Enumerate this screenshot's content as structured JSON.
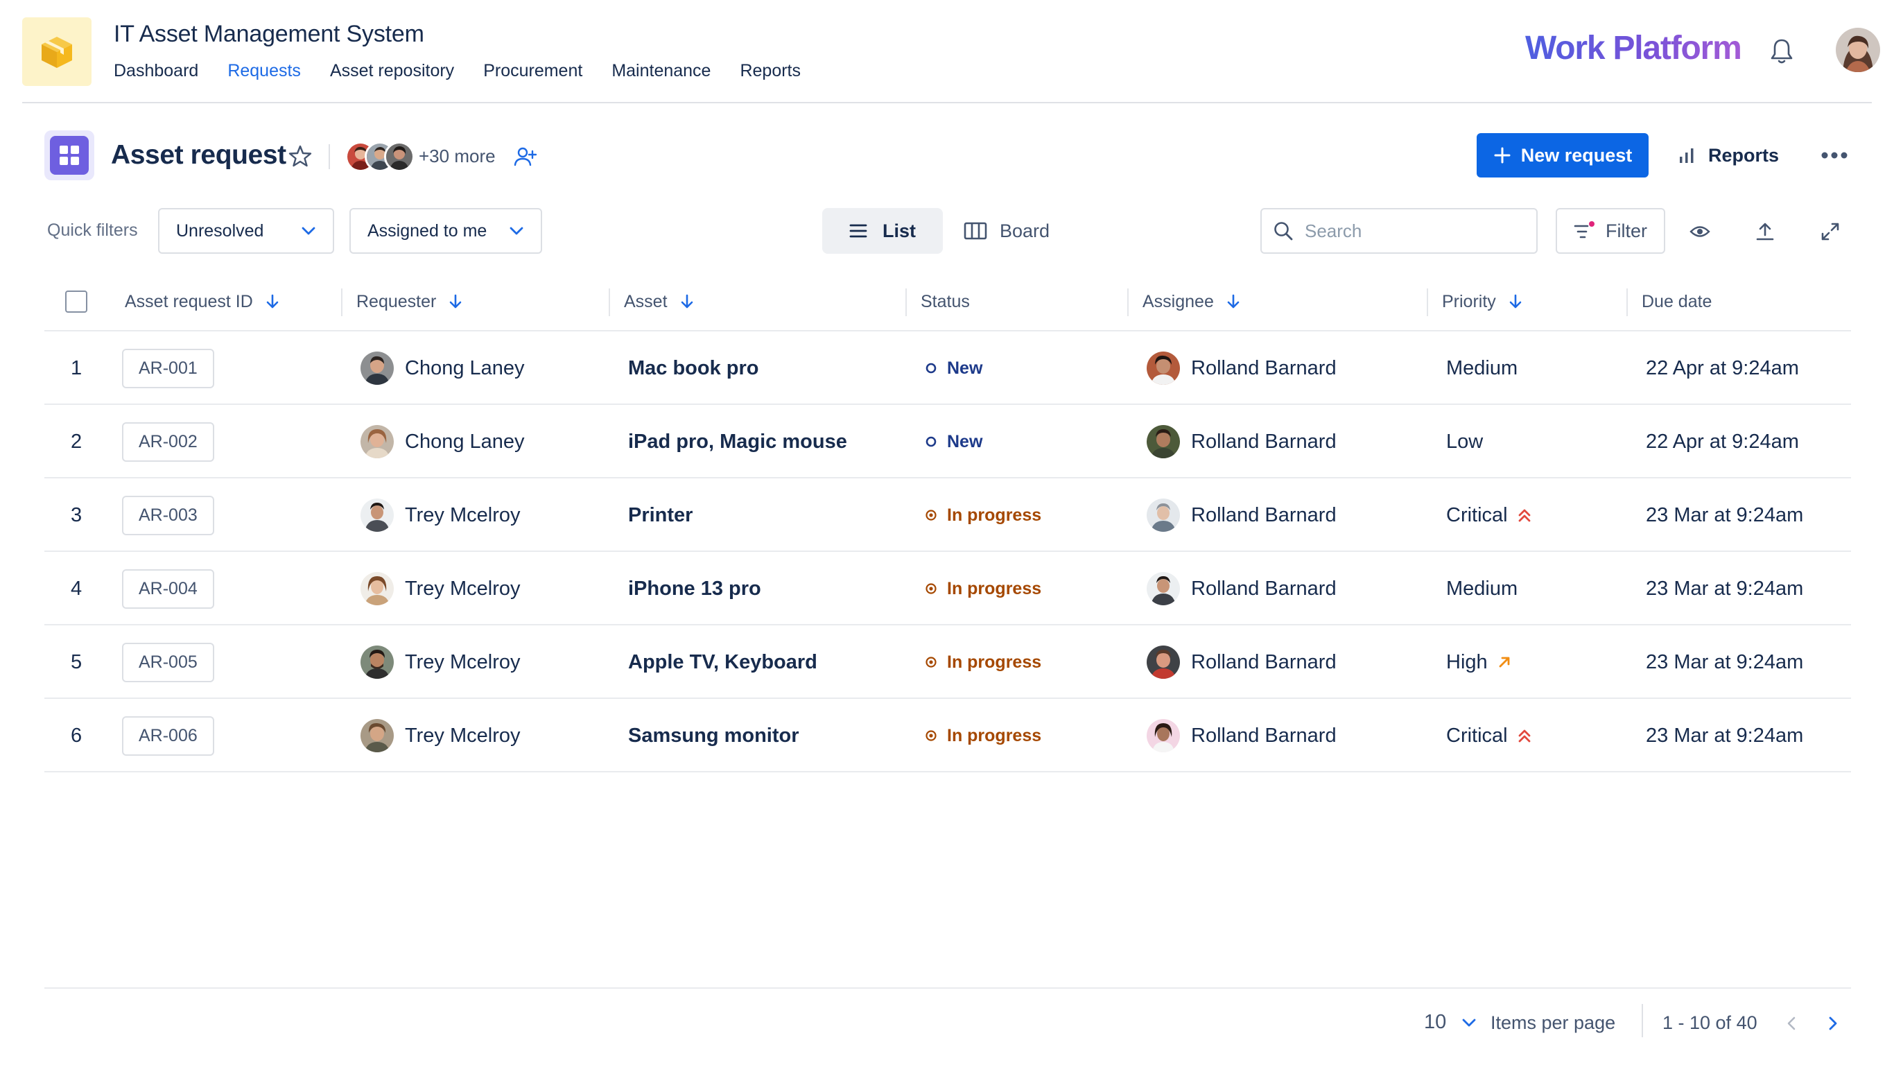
{
  "app": {
    "title": "IT Asset Management System",
    "brand": "Work Platform",
    "nav": [
      {
        "label": "Dashboard",
        "active": false
      },
      {
        "label": "Requests",
        "active": true
      },
      {
        "label": "Asset repository",
        "active": false
      },
      {
        "label": "Procurement",
        "active": false
      },
      {
        "label": "Maintenance",
        "active": false
      },
      {
        "label": "Reports",
        "active": false
      }
    ],
    "icons": {
      "logo": "box-icon",
      "notifications": "bell-icon",
      "user": "user-avatar"
    }
  },
  "header": {
    "title": "Asset request",
    "more_members": "+30 more",
    "new_request_label": "New request",
    "reports_label": "Reports"
  },
  "filters": {
    "quick_filters_label": "Quick filters",
    "status_select": "Unresolved",
    "assignee_select": "Assigned to me",
    "view_list_label": "List",
    "view_board_label": "Board",
    "search_placeholder": "Search",
    "filter_label": "Filter",
    "active_view": "List"
  },
  "table": {
    "columns": [
      "Asset request ID",
      "Requester",
      "Asset",
      "Status",
      "Assignee",
      "Priority",
      "Due date"
    ],
    "rows": [
      {
        "num": "1",
        "id": "AR-001",
        "requester": "Chong Laney",
        "asset": "Mac book pro",
        "status": "New",
        "assignee": "Rolland Barnard",
        "priority": "Medium",
        "priority_icon": "",
        "due": "22 Apr at 9:24am"
      },
      {
        "num": "2",
        "id": "AR-002",
        "requester": "Chong Laney",
        "asset": "iPad pro, Magic mouse",
        "status": "New",
        "assignee": "Rolland Barnard",
        "priority": "Low",
        "priority_icon": "",
        "due": "22 Apr at 9:24am"
      },
      {
        "num": "3",
        "id": "AR-003",
        "requester": "Trey Mcelroy",
        "asset": "Printer",
        "status": "In progress",
        "assignee": "Rolland Barnard",
        "priority": "Critical",
        "priority_icon": "double-chevron-up-icon",
        "due": "23 Mar at 9:24am"
      },
      {
        "num": "4",
        "id": "AR-004",
        "requester": "Trey Mcelroy",
        "asset": "iPhone 13 pro",
        "status": "In progress",
        "assignee": "Rolland Barnard",
        "priority": "Medium",
        "priority_icon": "",
        "due": "23 Mar at 9:24am"
      },
      {
        "num": "5",
        "id": "AR-005",
        "requester": "Trey Mcelroy",
        "asset": "Apple TV, Keyboard",
        "status": "In progress",
        "assignee": "Rolland Barnard",
        "priority": "High",
        "priority_icon": "arrow-up-right-icon",
        "due": "23 Mar at 9:24am"
      },
      {
        "num": "6",
        "id": "AR-006",
        "requester": "Trey Mcelroy",
        "asset": "Samsung monitor",
        "status": "In progress",
        "assignee": "Rolland Barnard",
        "priority": "Critical",
        "priority_icon": "double-chevron-up-icon",
        "due": "23 Mar at 9:24am"
      }
    ]
  },
  "pagination": {
    "per_page": "10",
    "per_page_label": "Items per page",
    "range": "1 - 10 of 40"
  },
  "colors": {
    "accent": "#0c66e4",
    "status_new": "#1d3a8a",
    "status_in_progress": "#a54800",
    "priority_critical": "#e2483d",
    "priority_high": "#f18d13",
    "project_icon": "#6e5fe0",
    "app_logo_bg": "#fdf3c9"
  }
}
